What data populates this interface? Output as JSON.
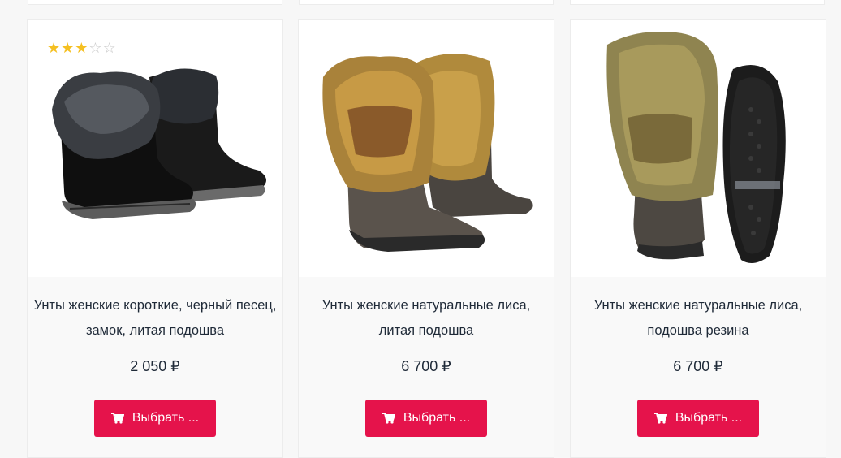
{
  "products": [
    {
      "title_lines": [
        "Унты женские короткие, черный песец,",
        "замок, литая подошва"
      ],
      "price": "2 050 ₽",
      "rating": 3,
      "rating_max": 5,
      "button_label": "Выбрать ..."
    },
    {
      "title_lines": [
        "Унты женские натуральные лиса,",
        "литая подошва"
      ],
      "price": "6 700 ₽",
      "button_label": "Выбрать ..."
    },
    {
      "title_lines": [
        "Унты женские натуральные лиса,",
        "подошва резина"
      ],
      "price": "6 700 ₽",
      "button_label": "Выбрать ..."
    }
  ],
  "icons": {
    "cart": "cart-icon",
    "star": "star-icon"
  },
  "colors": {
    "button": "#e5134b",
    "star": "#f5c022",
    "text": "#1f2a38"
  }
}
